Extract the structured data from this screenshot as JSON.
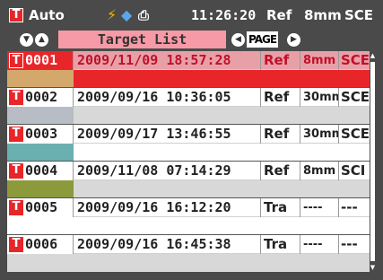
{
  "status": {
    "t_badge": "T",
    "mode": "Auto",
    "icons": [
      "battery-bolt-icon",
      "connection-icon",
      "printer-icon"
    ],
    "time": "11:26:20",
    "measure_mode": "Ref",
    "aperture": "8mm",
    "specular": "SCE"
  },
  "header": {
    "title": "Target List",
    "page_label": "PAGE",
    "nav_up": "▲",
    "nav_down": "▼",
    "page_prev": "◀",
    "page_next": "▶"
  },
  "rows": [
    {
      "t": "T",
      "id": "0001",
      "datetime": "2009/11/09 18:57:28",
      "mode": "Ref",
      "aperture": "8mm",
      "spec": "SCE",
      "swatch": "#d4a86a",
      "selected": true
    },
    {
      "t": "T",
      "id": "0002",
      "datetime": "2009/09/16 10:36:05",
      "mode": "Ref",
      "aperture": "30mm",
      "spec": "SCE",
      "swatch": "#b8bcc4",
      "selected": false
    },
    {
      "t": "T",
      "id": "0003",
      "datetime": "2009/09/17 13:46:55",
      "mode": "Ref",
      "aperture": "30mm",
      "spec": "SCE",
      "swatch": "#6ab0b0",
      "selected": false
    },
    {
      "t": "T",
      "id": "0004",
      "datetime": "2009/11/08 07:14:29",
      "mode": "Ref",
      "aperture": "8mm",
      "spec": "SCI",
      "swatch": "#8c9a3c",
      "selected": false
    },
    {
      "t": "T",
      "id": "0005",
      "datetime": "2009/09/16 16:12:20",
      "mode": "Tra",
      "aperture": "----",
      "spec": "---",
      "swatch": "#ffffff",
      "selected": false
    },
    {
      "t": "T",
      "id": "0006",
      "datetime": "2009/09/16 16:45:38",
      "mode": "Tra",
      "aperture": "----",
      "spec": "---",
      "swatch": "#d8d8d8",
      "selected": false
    }
  ],
  "scrollbar": {
    "up": "▲",
    "down": "▼"
  },
  "colors": {
    "accent_red": "#e8262a",
    "title_pink": "#f59aa6",
    "selected_row": "#e8a0a8",
    "chrome": "#4a4a4a"
  }
}
